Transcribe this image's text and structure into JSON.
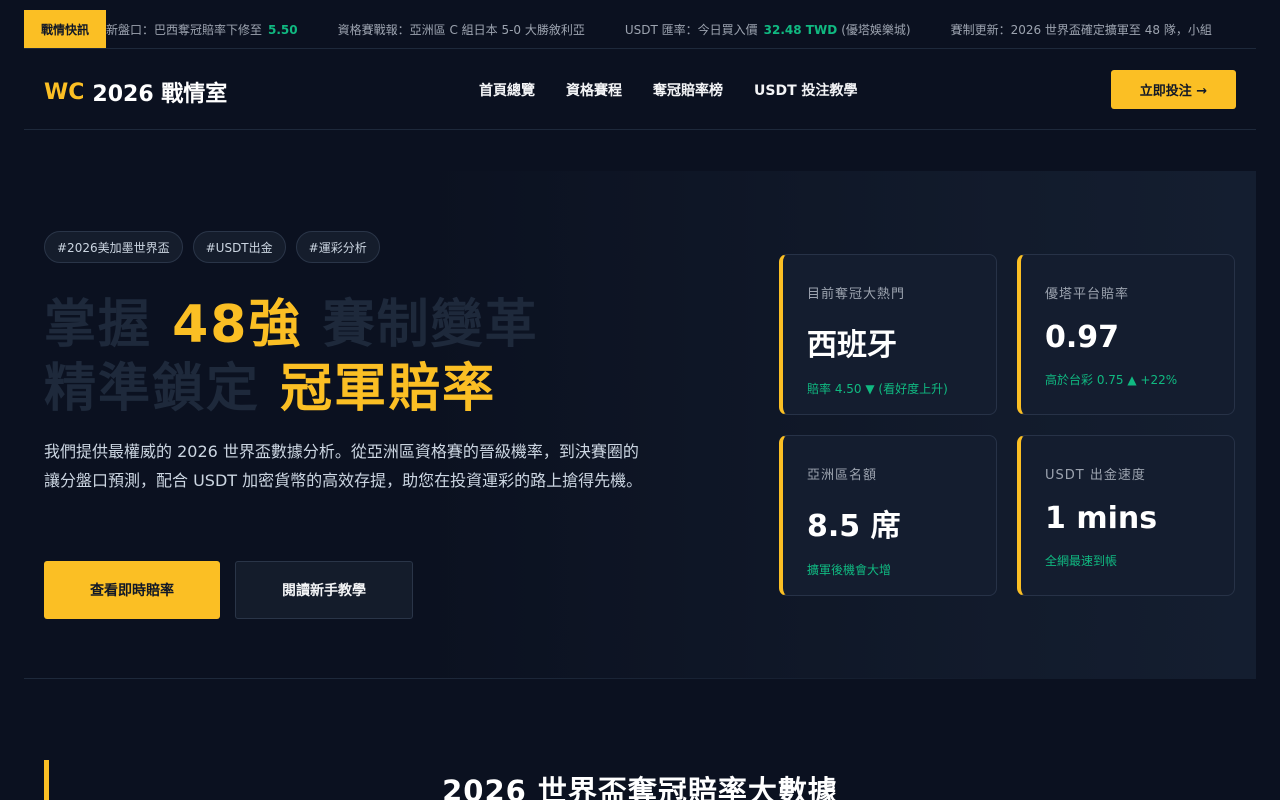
{
  "ticker": {
    "badge": "戰情快訊",
    "items": [
      {
        "text": "新盤口：巴西奪冠賠率下修至",
        "highlight": "5.50",
        "suffix": ""
      },
      {
        "text": "資格賽戰報：亞洲區 C 組日本 5-0 大勝敘利亞",
        "highlight": "",
        "suffix": ""
      },
      {
        "text": "USDT 匯率：今日買入價",
        "highlight": "32.48 TWD",
        "suffix": "(優塔娛樂城)"
      },
      {
        "text": "賽制更新：2026 世界盃確定擴軍至 48 隊，小組",
        "highlight": "",
        "suffix": ""
      }
    ]
  },
  "header": {
    "logo_accent": "WC",
    "logo_text": "2026 戰情室",
    "nav": [
      "首頁總覽",
      "資格賽程",
      "奪冠賠率榜",
      "USDT 投注教學"
    ],
    "cta": "立即投注 →"
  },
  "hero": {
    "tags": [
      "#2026美加墨世界盃",
      "#USDT出金",
      "#運彩分析"
    ],
    "headline": {
      "line1_a": "掌握 ",
      "line1_gold": "48強",
      "line1_b": " 賽制變革",
      "line2_a": "精準鎖定 ",
      "line2_gold": "冠軍賠率"
    },
    "description": "我們提供最權威的 2026 世界盃數據分析。從亞洲區資格賽的晉級機率，到決賽圈的讓分盤口預測，配合 USDT 加密貨幣的高效存提，助您在投資運彩的路上搶得先機。",
    "primary_button": "查看即時賠率",
    "secondary_button": "閱讀新手教學",
    "stats": [
      {
        "label": "目前奪冠大熱門",
        "value": "西班牙",
        "note": "賠率 4.50 ▼ (看好度上升)"
      },
      {
        "label": "優塔平台賠率",
        "value": "0.97",
        "note": "高於台彩 0.75 ▲ +22%"
      },
      {
        "label": "亞洲區名額",
        "value": "8.5 席",
        "note": "擴軍後機會大增"
      },
      {
        "label": "USDT 出金速度",
        "value": "1 mins",
        "note": "全網最速到帳"
      }
    ]
  },
  "section": {
    "title": "2026 世界盃奪冠賠率大數據"
  },
  "colors": {
    "accent": "#fbbf24",
    "positive": "#10b981",
    "background": "#0b1120"
  }
}
